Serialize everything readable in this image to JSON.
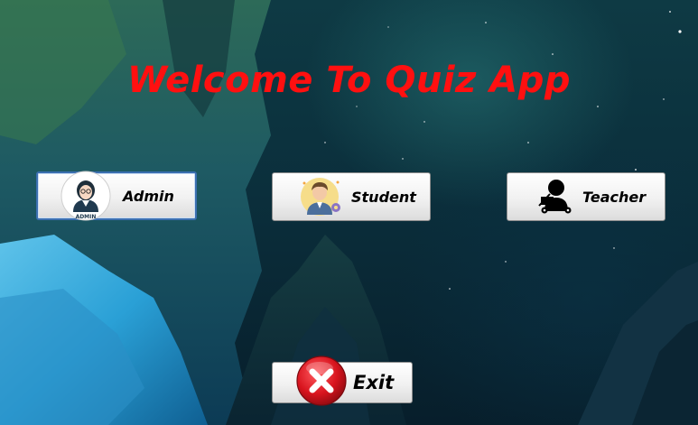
{
  "window": {
    "title": "Welcome To Quiz App"
  },
  "buttons": {
    "admin": {
      "label": "Admin",
      "icon": "admin-avatar-icon",
      "badge_text": "ADMIN"
    },
    "student": {
      "label": "Student",
      "icon": "student-avatar-icon"
    },
    "teacher": {
      "label": "Teacher",
      "icon": "teacher-icon"
    },
    "exit": {
      "label": "Exit",
      "icon": "close-x-icon"
    }
  },
  "colors": {
    "title": "#ff1010",
    "exit_icon": "#d8141e",
    "selected_border": "#3b6fb0"
  }
}
